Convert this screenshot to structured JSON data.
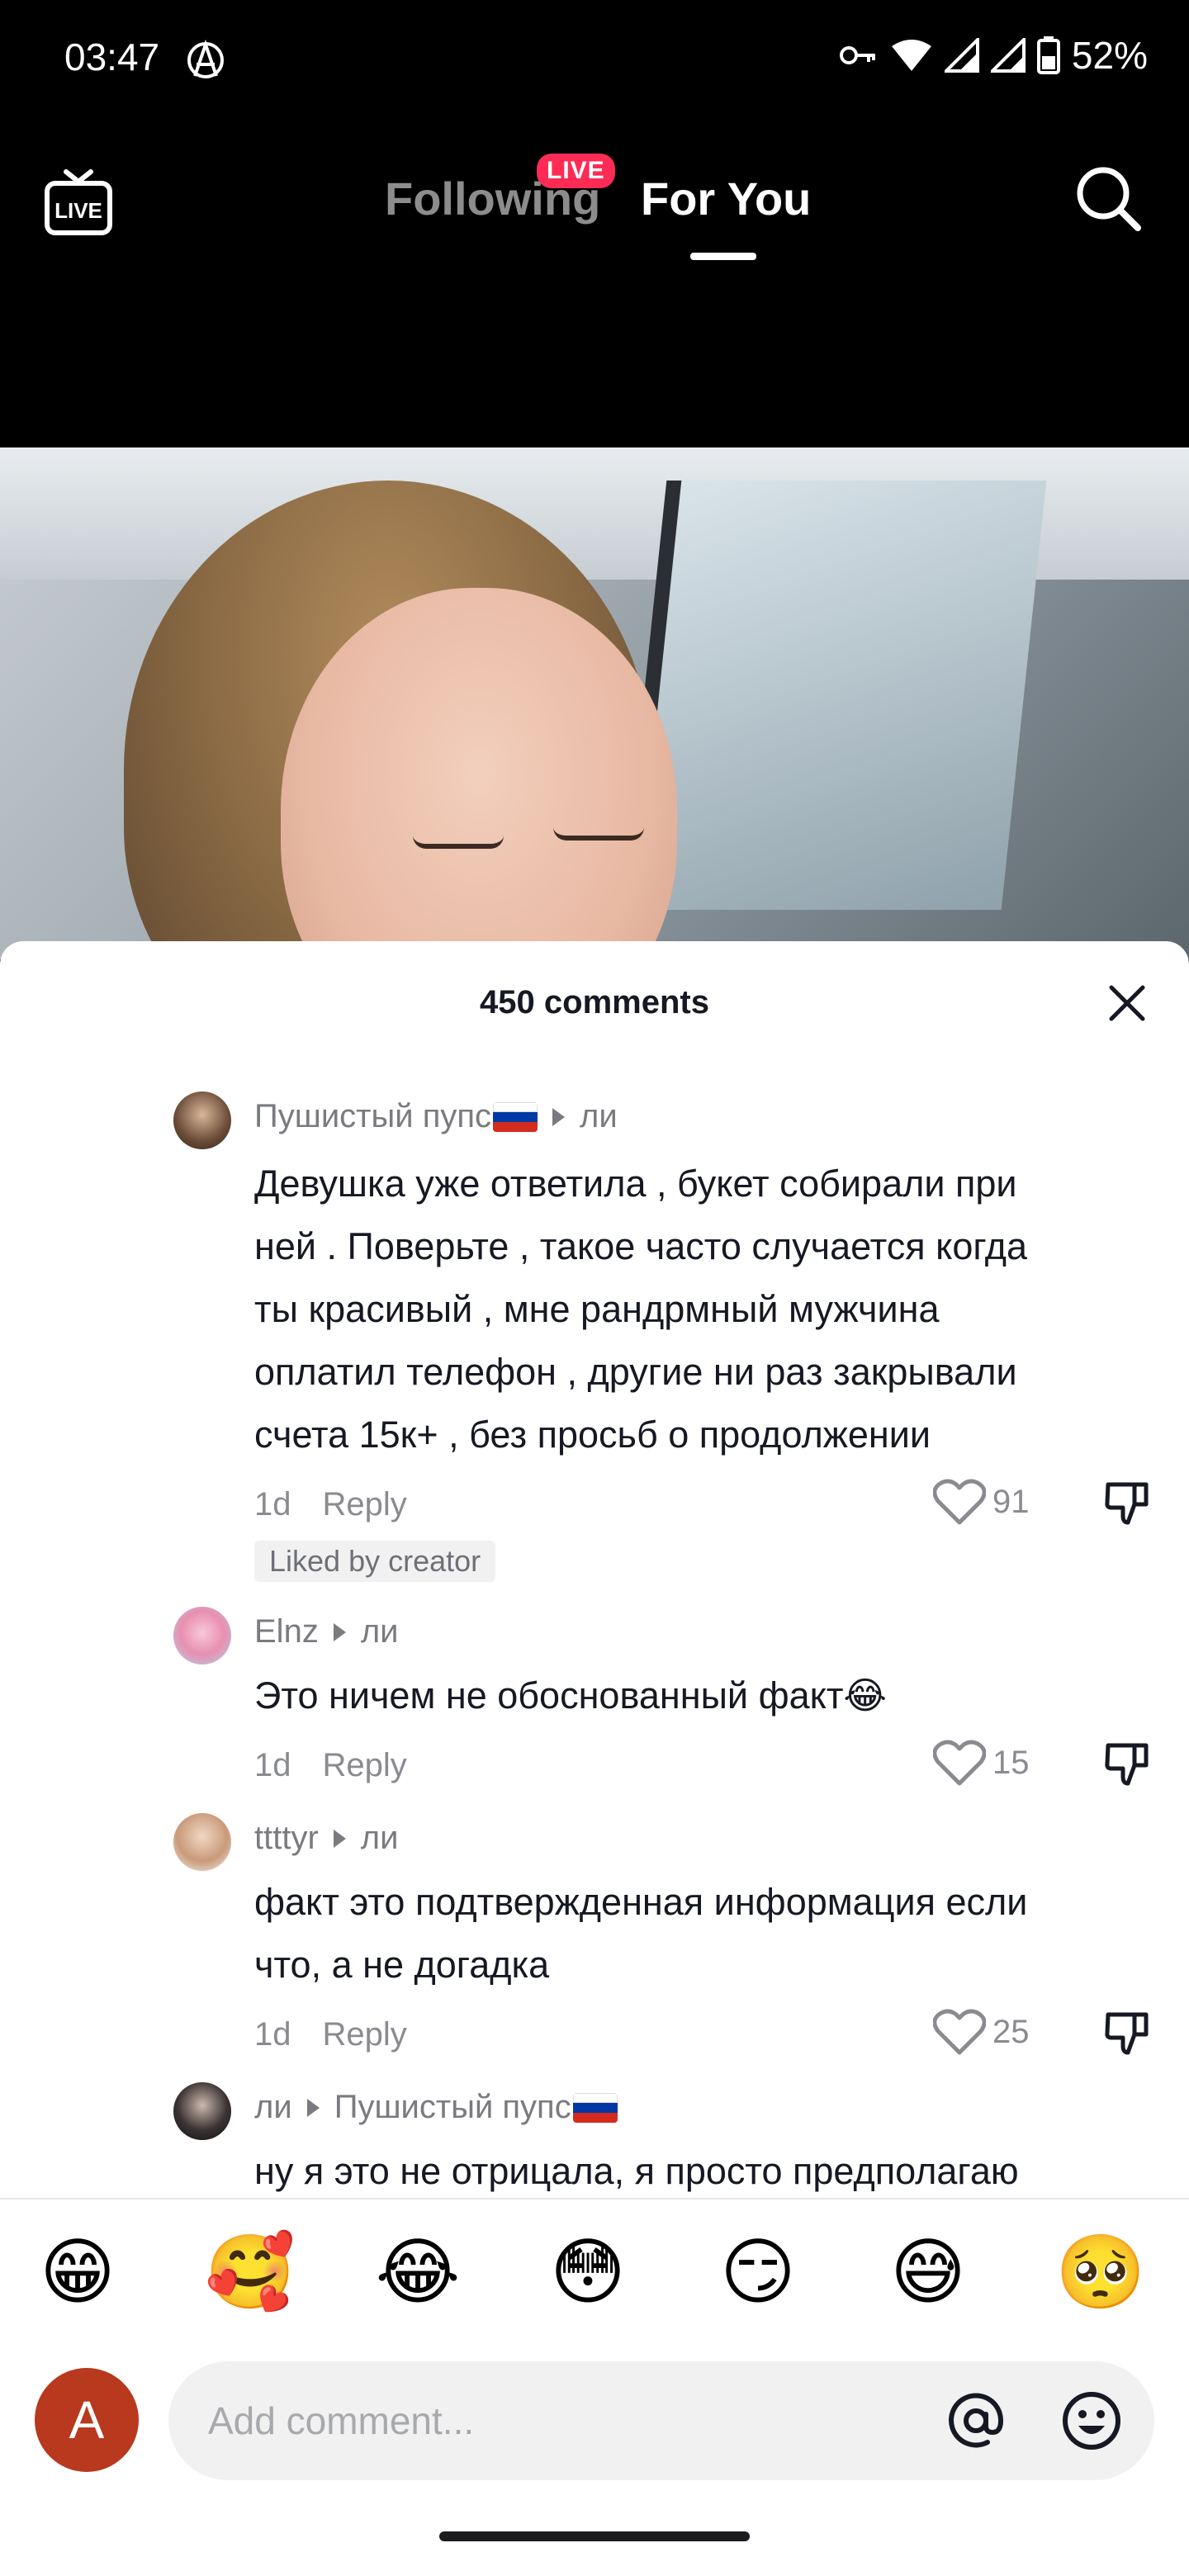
{
  "status_bar": {
    "time": "03:47",
    "battery": "52%"
  },
  "nav": {
    "following_label": "Following",
    "live_badge": "LIVE",
    "for_you_label": "For You",
    "live_icon_label": "LIVE"
  },
  "comments_header": {
    "count_label": "450 comments"
  },
  "comments": [
    {
      "user": "Пушистый пупс",
      "user_flag": "russia-flag",
      "reply_to": "ли",
      "text": "Девушка уже ответила , букет собирали при\nней . Поверьте , такое часто случается когда\nты красивый , мне рандрмный мужчина\nоплатил телефон , другие ни раз закрывали\nсчета 15к+ , без просьб о продолжении",
      "age": "1d",
      "reply_label": "Reply",
      "likes": "91",
      "liked_by_creator": "Liked by creator"
    },
    {
      "user": "Elnz",
      "reply_to": "ли",
      "text": "Это ничем не обоснованный факт😂",
      "age": "1d",
      "reply_label": "Reply",
      "likes": "15"
    },
    {
      "user": "ttttyr",
      "reply_to": "ли",
      "text": "факт это подтвержденная информация если\nчто, а не догадка",
      "age": "1d",
      "reply_label": "Reply",
      "likes": "25"
    },
    {
      "user": "ли",
      "reply_to": "Пушистый пупс",
      "reply_to_flag": "russia-flag",
      "text": "ну я это не отрицала, я просто предполагаю"
    }
  ],
  "emoji_bar": [
    "😁",
    "🥰",
    "😂",
    "😳",
    "😏",
    "😅",
    "🥺"
  ],
  "composer": {
    "avatar_letter": "A",
    "placeholder": "Add comment..."
  },
  "colors": {
    "live_badge": "#fe2c55",
    "my_avatar": "#b8391d",
    "russia_flag": [
      "#ffffff",
      "#0039a6",
      "#d52b1e"
    ]
  }
}
